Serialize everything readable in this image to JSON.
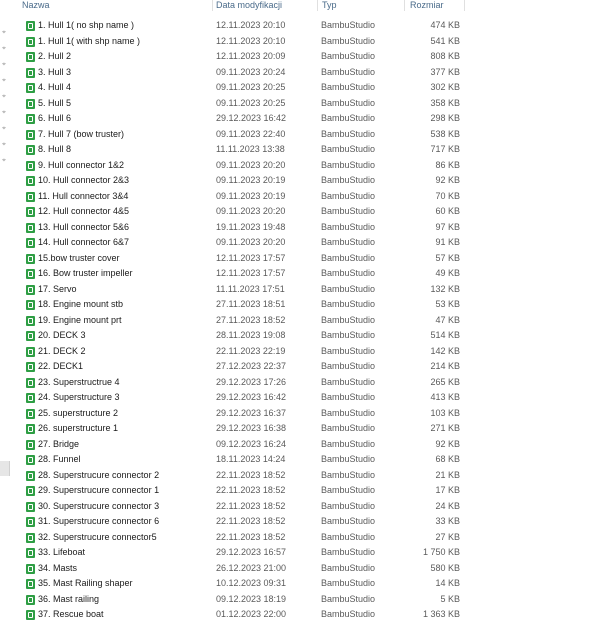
{
  "columns": {
    "name": "Nazwa",
    "date": "Data modyfikacji",
    "type": "Typ",
    "size": "Rozmiar"
  },
  "files": [
    {
      "name": "1. Hull 1( no shp name )",
      "date": "12.11.2023 20:10",
      "type": "BambuStudio",
      "size": "474 KB"
    },
    {
      "name": "1. Hull 1( with shp name )",
      "date": "12.11.2023 20:10",
      "type": "BambuStudio",
      "size": "541 KB"
    },
    {
      "name": "2. Hull 2",
      "date": "12.11.2023 20:09",
      "type": "BambuStudio",
      "size": "808 KB"
    },
    {
      "name": "3. Hull 3",
      "date": "09.11.2023 20:24",
      "type": "BambuStudio",
      "size": "377 KB"
    },
    {
      "name": "4. Hull 4",
      "date": "09.11.2023 20:25",
      "type": "BambuStudio",
      "size": "302 KB"
    },
    {
      "name": "5. Hull 5",
      "date": "09.11.2023 20:25",
      "type": "BambuStudio",
      "size": "358 KB"
    },
    {
      "name": "6. Hull 6",
      "date": "29.12.2023 16:42",
      "type": "BambuStudio",
      "size": "298 KB"
    },
    {
      "name": "7. Hull 7 (bow truster)",
      "date": "09.11.2023 22:40",
      "type": "BambuStudio",
      "size": "538 KB"
    },
    {
      "name": "8. Hull 8",
      "date": "11.11.2023 13:38",
      "type": "BambuStudio",
      "size": "717 KB"
    },
    {
      "name": "9. Hull connector 1&2",
      "date": "09.11.2023 20:20",
      "type": "BambuStudio",
      "size": "86 KB"
    },
    {
      "name": "10. Hull connector 2&3",
      "date": "09.11.2023 20:19",
      "type": "BambuStudio",
      "size": "92 KB"
    },
    {
      "name": "11. Hull connector 3&4",
      "date": "09.11.2023 20:19",
      "type": "BambuStudio",
      "size": "70 KB"
    },
    {
      "name": "12. Hull connector 4&5",
      "date": "09.11.2023 20:20",
      "type": "BambuStudio",
      "size": "60 KB"
    },
    {
      "name": "13. Hull connector 5&6",
      "date": "19.11.2023 19:48",
      "type": "BambuStudio",
      "size": "97 KB"
    },
    {
      "name": "14. Hull connector 6&7",
      "date": "09.11.2023 20:20",
      "type": "BambuStudio",
      "size": "91 KB"
    },
    {
      "name": "15.bow truster cover",
      "date": "12.11.2023 17:57",
      "type": "BambuStudio",
      "size": "57 KB"
    },
    {
      "name": "16. Bow truster impeller",
      "date": "12.11.2023 17:57",
      "type": "BambuStudio",
      "size": "49 KB"
    },
    {
      "name": "17. Servo",
      "date": "11.11.2023 17:51",
      "type": "BambuStudio",
      "size": "132 KB"
    },
    {
      "name": "18. Engine mount stb",
      "date": "27.11.2023 18:51",
      "type": "BambuStudio",
      "size": "53 KB"
    },
    {
      "name": "19. Engine mount prt",
      "date": "27.11.2023 18:52",
      "type": "BambuStudio",
      "size": "47 KB"
    },
    {
      "name": "20. DECK 3",
      "date": "28.11.2023 19:08",
      "type": "BambuStudio",
      "size": "514 KB"
    },
    {
      "name": "21. DECK 2",
      "date": "22.11.2023 22:19",
      "type": "BambuStudio",
      "size": "142 KB"
    },
    {
      "name": "22. DECK1",
      "date": "27.12.2023 22:37",
      "type": "BambuStudio",
      "size": "214 KB"
    },
    {
      "name": "23. Superstructrue 4",
      "date": "29.12.2023 17:26",
      "type": "BambuStudio",
      "size": "265 KB"
    },
    {
      "name": "24. Superstructure 3",
      "date": "29.12.2023 16:42",
      "type": "BambuStudio",
      "size": "413 KB"
    },
    {
      "name": "25. superstructure 2",
      "date": "29.12.2023 16:37",
      "type": "BambuStudio",
      "size": "103 KB"
    },
    {
      "name": "26. superstructure 1",
      "date": "29.12.2023 16:38",
      "type": "BambuStudio",
      "size": "271 KB"
    },
    {
      "name": "27. Bridge",
      "date": "09.12.2023 16:24",
      "type": "BambuStudio",
      "size": "92 KB"
    },
    {
      "name": "28. Funnel",
      "date": "18.11.2023 14:24",
      "type": "BambuStudio",
      "size": "68 KB"
    },
    {
      "name": "28. Superstrucure connector 2",
      "date": "22.11.2023 18:52",
      "type": "BambuStudio",
      "size": "21 KB"
    },
    {
      "name": "29. Superstrucure connector 1",
      "date": "22.11.2023 18:52",
      "type": "BambuStudio",
      "size": "17 KB"
    },
    {
      "name": "30. Superstrucure connector 3",
      "date": "22.11.2023 18:52",
      "type": "BambuStudio",
      "size": "24 KB"
    },
    {
      "name": "31. Superstrucure connector 6",
      "date": "22.11.2023 18:52",
      "type": "BambuStudio",
      "size": "33 KB"
    },
    {
      "name": "32. Superstrucure connector5",
      "date": "22.11.2023 18:52",
      "type": "BambuStudio",
      "size": "27 KB"
    },
    {
      "name": "33. Lifeboat",
      "date": "29.12.2023 16:57",
      "type": "BambuStudio",
      "size": "1 750 KB"
    },
    {
      "name": "34. Masts",
      "date": "26.12.2023 21:00",
      "type": "BambuStudio",
      "size": "580 KB"
    },
    {
      "name": "35. Mast Railing shaper",
      "date": "10.12.2023 09:31",
      "type": "BambuStudio",
      "size": "14 KB"
    },
    {
      "name": "36. Mast railing",
      "date": "09.12.2023 18:19",
      "type": "BambuStudio",
      "size": "5 KB"
    },
    {
      "name": "37. Rescue boat",
      "date": "01.12.2023 22:00",
      "type": "BambuStudio",
      "size": "1 363 KB"
    }
  ],
  "icon": {
    "file": "bambustudio-file-icon",
    "color": "#2e9e44"
  }
}
